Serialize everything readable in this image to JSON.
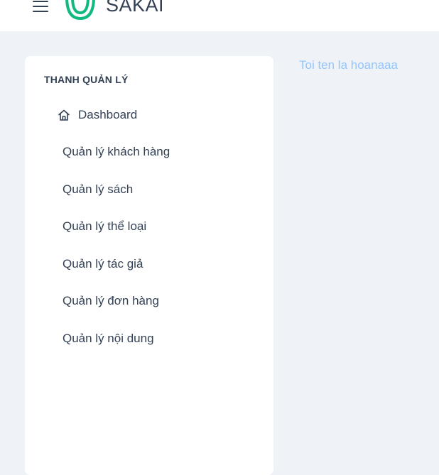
{
  "header": {
    "brand": "SAKAI",
    "logo_icon": "sakai-logo-icon",
    "menu_icon": "hamburger-menu-icon",
    "logo_color": "#10b981"
  },
  "sidebar": {
    "section_title": "THANH QUẢN LÝ",
    "items": [
      {
        "label": "Dashboard",
        "icon": "home-icon"
      },
      {
        "label": "Quản lý khách hàng"
      },
      {
        "label": "Quản lý sách"
      },
      {
        "label": "Quản lý thể loại"
      },
      {
        "label": "Quản lý tác giả"
      },
      {
        "label": "Quản lý đơn hàng"
      },
      {
        "label": "Quản lý nội dung"
      }
    ]
  },
  "main": {
    "text": "Toi ten la hoanaaa"
  }
}
